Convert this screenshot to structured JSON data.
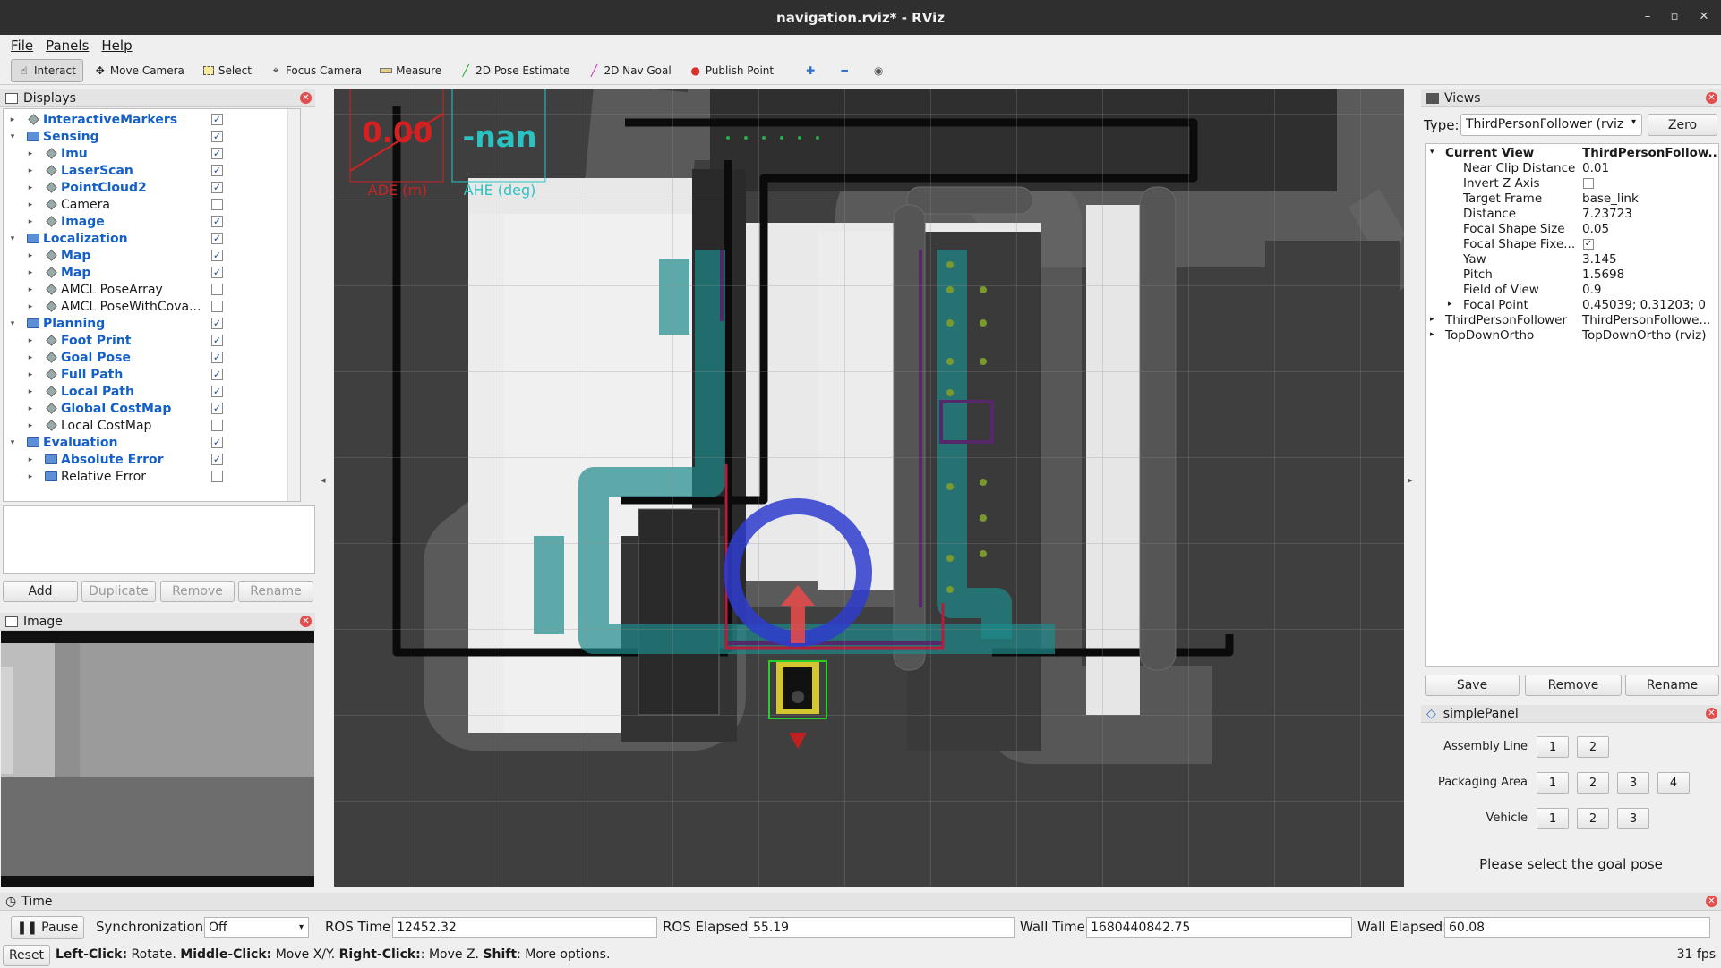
{
  "window": {
    "title": "navigation.rviz* - RViz",
    "min": "–",
    "max": "▫",
    "close": "✕"
  },
  "menu": [
    "File",
    "Panels",
    "Help"
  ],
  "toolbar": {
    "tools": [
      "Interact",
      "Move Camera",
      "Select",
      "Focus Camera",
      "Measure",
      "2D Pose Estimate",
      "2D Nav Goal",
      "Publish Point"
    ],
    "icons": [
      "plus-icon",
      "minus-icon",
      "eye-icon"
    ]
  },
  "displays": {
    "title": "Displays",
    "items": [
      {
        "label": "InteractiveMarkers",
        "depth": 0,
        "kind": "plugin",
        "expand": "▸",
        "checked": true,
        "blue": true
      },
      {
        "label": "Sensing",
        "depth": 0,
        "kind": "folder",
        "expand": "▾",
        "checked": true,
        "blue": true
      },
      {
        "label": "Imu",
        "depth": 1,
        "kind": "plugin",
        "expand": "▸",
        "checked": true,
        "blue": true
      },
      {
        "label": "LaserScan",
        "depth": 1,
        "kind": "plugin",
        "expand": "▸",
        "checked": true,
        "blue": true
      },
      {
        "label": "PointCloud2",
        "depth": 1,
        "kind": "plugin",
        "expand": "▸",
        "checked": true,
        "blue": true
      },
      {
        "label": "Camera",
        "depth": 1,
        "kind": "plugin",
        "expand": "▸",
        "checked": false,
        "blue": false
      },
      {
        "label": "Image",
        "depth": 1,
        "kind": "plugin",
        "expand": "▸",
        "checked": true,
        "blue": true
      },
      {
        "label": "Localization",
        "depth": 0,
        "kind": "folder",
        "expand": "▾",
        "checked": true,
        "blue": true
      },
      {
        "label": "Map",
        "depth": 1,
        "kind": "plugin",
        "expand": "▸",
        "checked": true,
        "blue": true
      },
      {
        "label": "Map",
        "depth": 1,
        "kind": "plugin",
        "expand": "▸",
        "checked": true,
        "blue": true
      },
      {
        "label": "AMCL PoseArray",
        "depth": 1,
        "kind": "plugin",
        "expand": "▸",
        "checked": false,
        "blue": false
      },
      {
        "label": "AMCL PoseWithCova...",
        "depth": 1,
        "kind": "plugin",
        "expand": "▸",
        "checked": false,
        "blue": false
      },
      {
        "label": "Planning",
        "depth": 0,
        "kind": "folder",
        "expand": "▾",
        "checked": true,
        "blue": true
      },
      {
        "label": "Foot Print",
        "depth": 1,
        "kind": "plugin",
        "expand": "▸",
        "checked": true,
        "blue": true
      },
      {
        "label": "Goal Pose",
        "depth": 1,
        "kind": "plugin",
        "expand": "▸",
        "checked": true,
        "blue": true
      },
      {
        "label": "Full Path",
        "depth": 1,
        "kind": "plugin",
        "expand": "▸",
        "checked": true,
        "blue": true
      },
      {
        "label": "Local Path",
        "depth": 1,
        "kind": "plugin",
        "expand": "▸",
        "checked": true,
        "blue": true
      },
      {
        "label": "Global CostMap",
        "depth": 1,
        "kind": "plugin",
        "expand": "▸",
        "checked": true,
        "blue": true
      },
      {
        "label": "Local CostMap",
        "depth": 1,
        "kind": "plugin",
        "expand": "▸",
        "checked": false,
        "blue": false
      },
      {
        "label": "Evaluation",
        "depth": 0,
        "kind": "folder",
        "expand": "▾",
        "checked": true,
        "blue": true
      },
      {
        "label": "Absolute Error",
        "depth": 1,
        "kind": "folder",
        "expand": "▸",
        "checked": true,
        "blue": true
      },
      {
        "label": "Relative Error",
        "depth": 1,
        "kind": "folder",
        "expand": "▸",
        "checked": false,
        "blue": false
      }
    ],
    "buttons": {
      "add": "Add",
      "duplicate": "Duplicate",
      "remove": "Remove",
      "rename": "Rename"
    }
  },
  "image_panel": {
    "title": "Image"
  },
  "overlay": {
    "ade_value": "0.00",
    "ade_label": "ADE (m)",
    "ahe_value": "-nan",
    "ahe_label": "AHE (deg)"
  },
  "views": {
    "title": "Views",
    "type_label": "Type:",
    "type_value": "ThirdPersonFollower (rviz",
    "zero": "Zero",
    "rows": [
      {
        "key": "Current View",
        "value": "ThirdPersonFollow...",
        "depth": 0,
        "bold": true,
        "expand": "▾",
        "check": false
      },
      {
        "key": "Near Clip Distance",
        "value": "0.01",
        "depth": 1,
        "bold": false,
        "expand": "",
        "check": false
      },
      {
        "key": "Invert Z Axis",
        "value": "",
        "depth": 1,
        "bold": false,
        "expand": "",
        "check": "off"
      },
      {
        "key": "Target Frame",
        "value": "base_link",
        "depth": 1,
        "bold": false,
        "expand": "",
        "check": false
      },
      {
        "key": "Distance",
        "value": "7.23723",
        "depth": 1,
        "bold": false,
        "expand": "",
        "check": false
      },
      {
        "key": "Focal Shape Size",
        "value": "0.05",
        "depth": 1,
        "bold": false,
        "expand": "",
        "check": false
      },
      {
        "key": "Focal Shape Fixe...",
        "value": "",
        "depth": 1,
        "bold": false,
        "expand": "",
        "check": "on"
      },
      {
        "key": "Yaw",
        "value": "3.145",
        "depth": 1,
        "bold": false,
        "expand": "",
        "check": false
      },
      {
        "key": "Pitch",
        "value": "1.5698",
        "depth": 1,
        "bold": false,
        "expand": "",
        "check": false
      },
      {
        "key": "Field of View",
        "value": "0.9",
        "depth": 1,
        "bold": false,
        "expand": "",
        "check": false
      },
      {
        "key": "Focal Point",
        "value": "0.45039; 0.31203; 0",
        "depth": 1,
        "bold": false,
        "expand": "▸",
        "check": false
      },
      {
        "key": "ThirdPersonFollower",
        "value": "ThirdPersonFollowe...",
        "depth": 0,
        "bold": false,
        "expand": "▸",
        "check": false
      },
      {
        "key": "TopDownOrtho",
        "value": "TopDownOrtho (rviz)",
        "depth": 0,
        "bold": false,
        "expand": "▸",
        "check": false
      }
    ],
    "save": "Save",
    "remove": "Remove",
    "rename": "Rename"
  },
  "simple_panel": {
    "title": "simplePanel",
    "groups": [
      {
        "label": "Assembly Line",
        "buttons": [
          "1",
          "2"
        ]
      },
      {
        "label": "Packaging Area",
        "buttons": [
          "1",
          "2",
          "3",
          "4"
        ]
      },
      {
        "label": "Vehicle",
        "buttons": [
          "1",
          "2",
          "3"
        ]
      }
    ],
    "status": "Please select the goal pose"
  },
  "time_panel": {
    "title": "Time",
    "pause": "Pause",
    "sync_label": "Synchronization:",
    "sync_value": "Off",
    "ros_time_label": "ROS Time:",
    "ros_time": "12452.32",
    "ros_elapsed_label": "ROS Elapsed:",
    "ros_elapsed": "55.19",
    "wall_time_label": "Wall Time:",
    "wall_time": "1680440842.75",
    "wall_elapsed_label": "Wall Elapsed:",
    "wall_elapsed": "60.08"
  },
  "status_bar": {
    "reset": "Reset",
    "b1": "Left-Click:",
    "t1": " Rotate. ",
    "b2": "Middle-Click:",
    "t2": " Move X/Y. ",
    "b3": "Right-Click:",
    "t3": ": Move Z. ",
    "b4": "Shift",
    "t4": ": More options.",
    "fps": "31 fps"
  }
}
